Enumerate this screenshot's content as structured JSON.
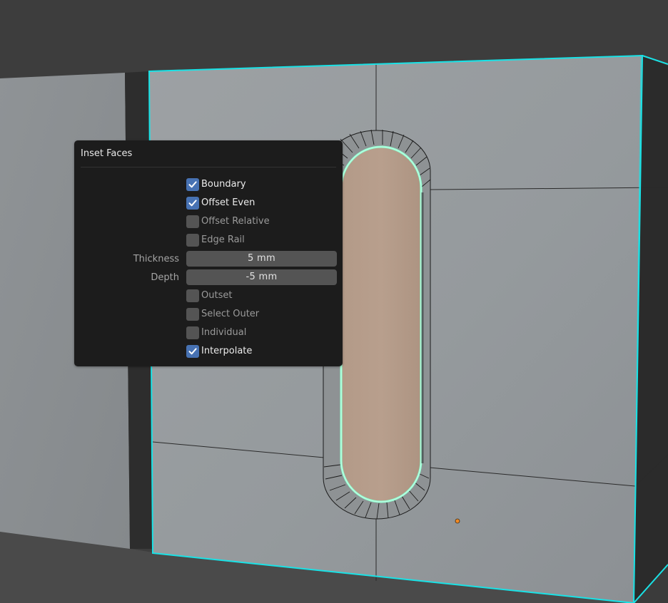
{
  "panel": {
    "title": "Inset Faces",
    "options": [
      {
        "label": "Boundary",
        "checked": true
      },
      {
        "label": "Offset Even",
        "checked": true
      },
      {
        "label": "Offset Relative",
        "checked": false
      },
      {
        "label": "Edge Rail",
        "checked": false
      }
    ],
    "thickness": {
      "label": "Thickness",
      "value": "5 mm"
    },
    "depth": {
      "label": "Depth",
      "value": "-5 mm"
    },
    "options2": [
      {
        "label": "Outset",
        "checked": false
      },
      {
        "label": "Select Outer",
        "checked": false
      },
      {
        "label": "Individual",
        "checked": false
      },
      {
        "label": "Interpolate",
        "checked": true
      }
    ]
  },
  "colors": {
    "panel_bg": "#1c1c1c",
    "checkbox_on": "#4772b3",
    "checkbox_off": "#545454",
    "field_bg": "#545454",
    "selection_outline": "#1ee0e0",
    "selected_face": "#b79d8a",
    "face_outline": "#7fffd4",
    "object_origin": "#f08a24"
  },
  "icons": [
    "checkmark-icon"
  ]
}
